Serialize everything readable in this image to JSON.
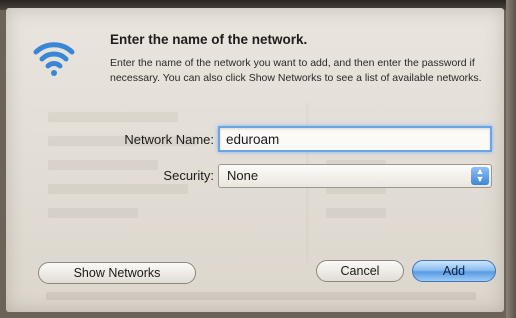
{
  "dialog": {
    "title": "Enter the name of the network.",
    "description": "Enter the name of the network you want to add, and then enter the password if necessary. You can also click Show Networks to see a list of available networks."
  },
  "form": {
    "network_name_label": "Network Name:",
    "network_name_value": "eduroam",
    "security_label": "Security:",
    "security_value": "None"
  },
  "buttons": {
    "show_networks": "Show Networks",
    "cancel": "Cancel",
    "add": "Add"
  },
  "icons": {
    "wifi": "wifi-icon",
    "stepper": "updown-stepper-icon"
  },
  "colors": {
    "accent": "#5a9be3",
    "wifi": "#3a86d6",
    "focus_ring": "#6aa4e8"
  }
}
